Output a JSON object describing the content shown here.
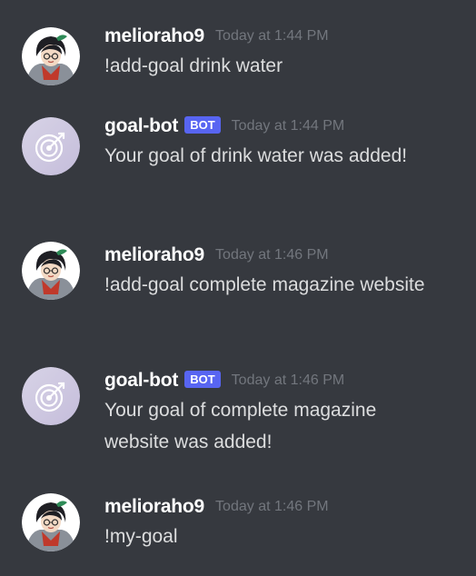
{
  "messages": [
    {
      "author": "melioraho9",
      "is_bot": false,
      "avatar_icon": "user-avatar-icon",
      "timestamp": "Today at 1:44 PM",
      "text": "!add-goal drink water"
    },
    {
      "author": "goal-bot",
      "is_bot": true,
      "bot_tag": "BOT",
      "avatar_icon": "target-avatar-icon",
      "timestamp": "Today at 1:44 PM",
      "text": "Your goal of  drink water was added!"
    },
    {
      "author": "melioraho9",
      "is_bot": false,
      "avatar_icon": "user-avatar-icon",
      "timestamp": "Today at 1:46 PM",
      "text": "!add-goal complete magazine website"
    },
    {
      "author": "goal-bot",
      "is_bot": true,
      "bot_tag": "BOT",
      "avatar_icon": "target-avatar-icon",
      "timestamp": "Today at 1:46 PM",
      "text": "Your goal of  complete magazine website was added!"
    },
    {
      "author": "melioraho9",
      "is_bot": false,
      "avatar_icon": "user-avatar-icon",
      "timestamp": "Today at 1:46 PM",
      "text": "!my-goal"
    }
  ],
  "colors": {
    "background": "#36393f",
    "username": "#ffffff",
    "bot_tag": "#5865f2",
    "timestamp": "#72767d",
    "message_text": "#dcddde"
  }
}
